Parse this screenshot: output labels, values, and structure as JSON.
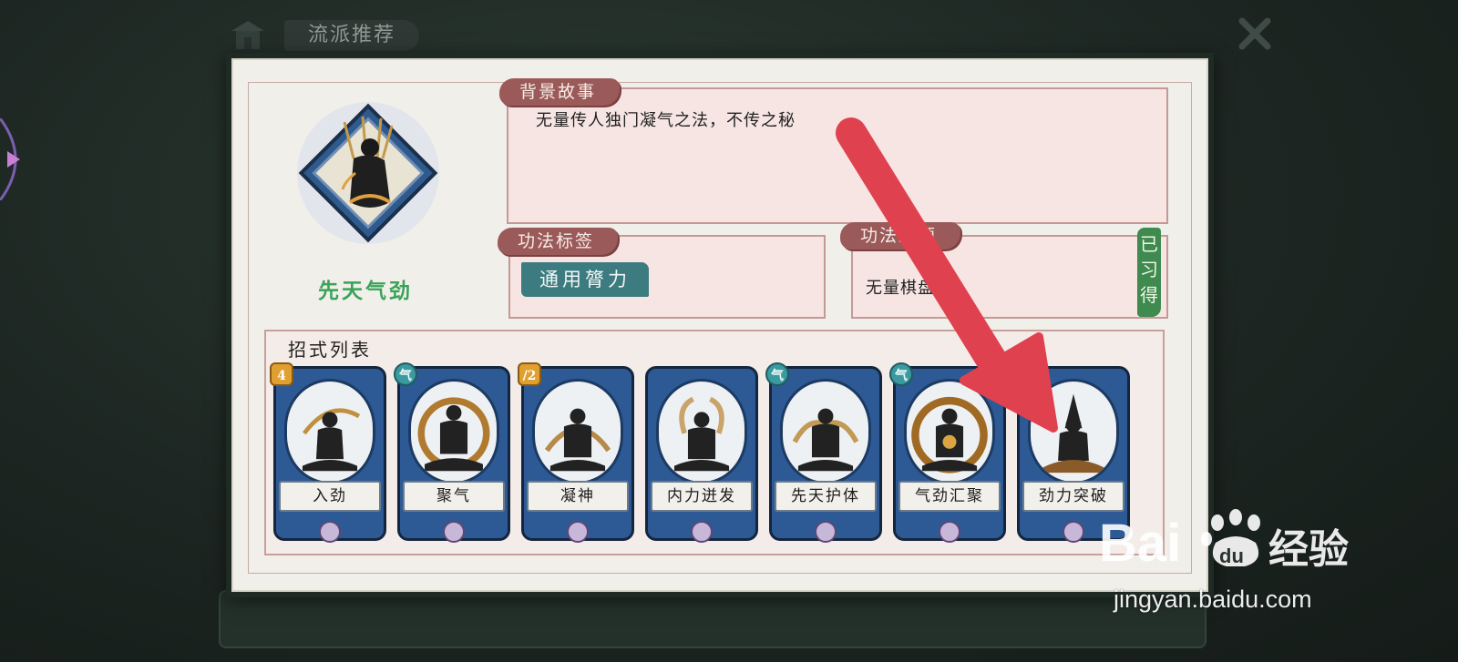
{
  "header": {
    "title": "流派推荐"
  },
  "skill": {
    "name": "先天气劲",
    "portrait_icon": "meditating-warrior-icon"
  },
  "sections": {
    "background": {
      "label": "背景故事",
      "text": "无量传人独门凝气之法，不传之秘"
    },
    "tags": {
      "label": "功法标签",
      "value": "通用膂力"
    },
    "source": {
      "label": "功法来源",
      "value": "无量棋盘",
      "status": "已习得"
    }
  },
  "moves": {
    "label": "招式列表",
    "cards": [
      {
        "name": "入劲",
        "badge": "4",
        "badge_type": "number"
      },
      {
        "name": "聚气",
        "badge": "气",
        "badge_type": "qi"
      },
      {
        "name": "凝神",
        "badge": "/2",
        "badge_type": "number"
      },
      {
        "name": "内力迸发",
        "badge": "",
        "badge_type": "none"
      },
      {
        "name": "先天护体",
        "badge": "气",
        "badge_type": "qi"
      },
      {
        "name": "气劲汇聚",
        "badge": "气",
        "badge_type": "qi"
      },
      {
        "name": "劲力突破",
        "badge": "",
        "badge_type": "none"
      }
    ]
  },
  "watermark": {
    "brand": "Baidu经验",
    "url": "jingyan.baidu.com"
  },
  "colors": {
    "skill_name": "#3aa35a",
    "section_tag": "#9b5a5a",
    "tag_chip": "#3c7c80",
    "learned": "#3e8a4f",
    "card": "#2d5a94",
    "annotation_arrow": "#e0414f"
  }
}
